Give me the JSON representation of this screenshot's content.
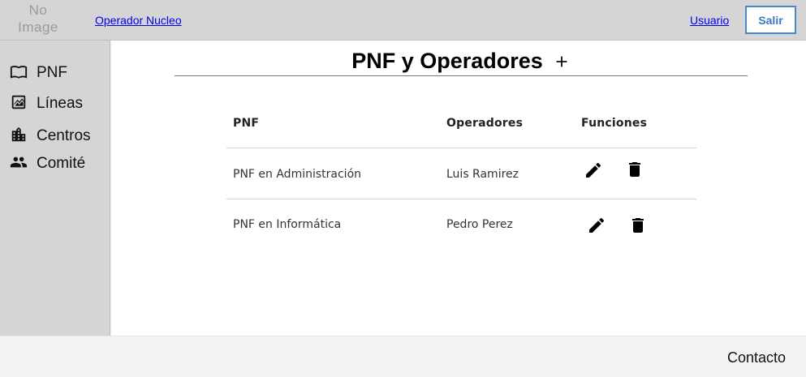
{
  "header": {
    "logo_text": "No Image",
    "nucleo_link": "Operador Nucleo",
    "usuario_link": "Usuario",
    "salir_label": "Salir",
    "accent_color": "#4a86c8"
  },
  "sidebar": {
    "items": [
      {
        "label": "PNF",
        "icon": "book-open-icon"
      },
      {
        "label": "Líneas",
        "icon": "line-chart-icon"
      },
      {
        "label": "Centros",
        "icon": "city-icon"
      },
      {
        "label": "Comité",
        "icon": "people-icon"
      }
    ]
  },
  "main": {
    "title": "PNF y Operadores",
    "table": {
      "headers": [
        "PNF",
        "Operadores",
        "Funciones"
      ],
      "rows": [
        {
          "pnf": "PNF en Administración",
          "operador": "Luis Ramirez"
        },
        {
          "pnf": "PNF en Informática",
          "operador": "Pedro Perez"
        }
      ]
    }
  },
  "footer": {
    "contacto": "Contacto"
  }
}
